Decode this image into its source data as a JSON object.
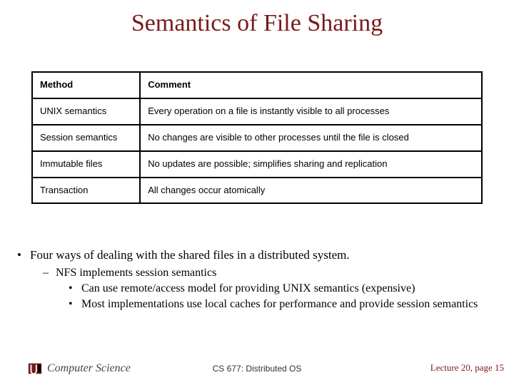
{
  "title": "Semantics of File Sharing",
  "table": {
    "headers": {
      "method": "Method",
      "comment": "Comment"
    },
    "rows": [
      {
        "method": "UNIX semantics",
        "comment": "Every operation on a file is instantly visible to all processes"
      },
      {
        "method": "Session semantics",
        "comment": "No changes are visible to other processes until the file is closed"
      },
      {
        "method": "Immutable files",
        "comment": "No updates are possible; simplifies sharing and replication"
      },
      {
        "method": "Transaction",
        "comment": "All changes occur atomically"
      }
    ]
  },
  "bullets": {
    "lvl1": "Four ways of dealing with the shared files in a distributed system.",
    "lvl2": "NFS implements session semantics",
    "lvl3a": "Can use remote/access model for providing UNIX semantics (expensive)",
    "lvl3b": "Most implementations use local caches for performance  and  provide session semantics"
  },
  "footer": {
    "affiliation": "Computer Science",
    "course": "CS 677: Distributed OS",
    "page": "Lecture 20, page 15"
  },
  "glyphs": {
    "bullet": "•",
    "dash": "–"
  }
}
